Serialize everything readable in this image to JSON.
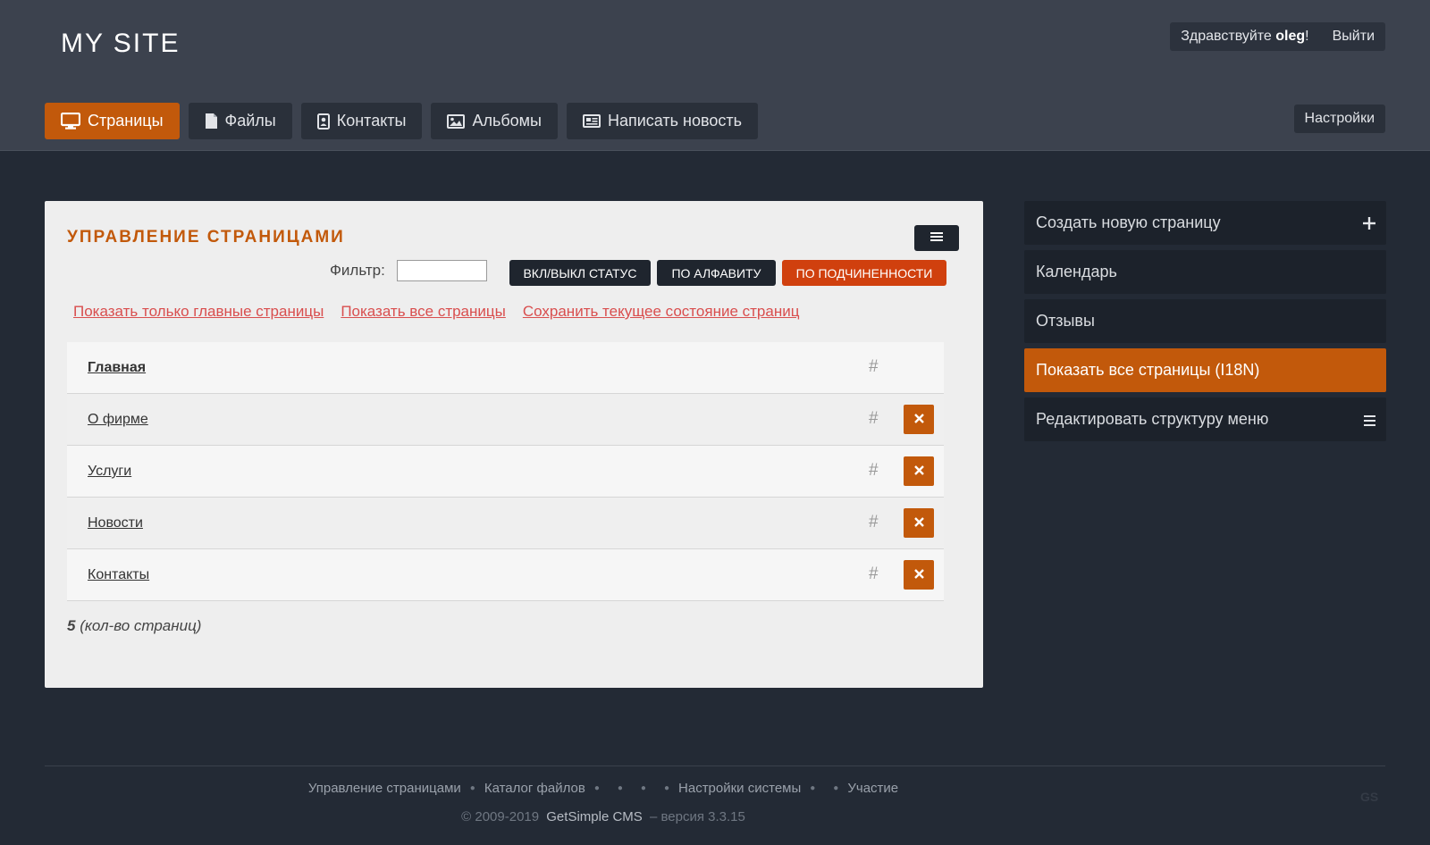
{
  "header": {
    "site_title": "MY SITE",
    "greeting_prefix": "Здравствуйте ",
    "username": "oleg",
    "greeting_suffix": "!",
    "logout_label": "Выйти",
    "settings_label": "Настройки"
  },
  "nav": {
    "tabs": [
      {
        "label": "Страницы",
        "icon": "monitor-icon",
        "active": true
      },
      {
        "label": "Файлы",
        "icon": "file-icon",
        "active": false
      },
      {
        "label": "Контакты",
        "icon": "contact-card-icon",
        "active": false
      },
      {
        "label": "Альбомы",
        "icon": "image-icon",
        "active": false
      },
      {
        "label": "Написать новость",
        "icon": "newspaper-icon",
        "active": false
      }
    ]
  },
  "panel": {
    "title": "УПРАВЛЕНИЕ СТРАНИЦАМИ",
    "menu_icon": "hamburger-icon",
    "filter_label": "Фильтр:",
    "filter_value": "",
    "sort_buttons": [
      {
        "label": "ВКЛ/ВЫКЛ СТАТУС"
      },
      {
        "label": "ПО АЛФАВИТУ"
      },
      {
        "label": "ПО ПОДЧИНЕННОСТИ"
      }
    ],
    "links": [
      "Показать только главные страницы",
      "Показать все страницы",
      "Сохранить текущее состояние страниц"
    ],
    "pages": [
      {
        "title": "Главная",
        "hash": "#",
        "deletable": false
      },
      {
        "title": "О фирме",
        "hash": "#",
        "deletable": true
      },
      {
        "title": "Услуги",
        "hash": "#",
        "deletable": true
      },
      {
        "title": "Новости",
        "hash": "#",
        "deletable": true
      },
      {
        "title": "Контакты",
        "hash": "#",
        "deletable": true
      }
    ],
    "count_number": "5",
    "count_label": " (кол-во страниц)"
  },
  "sidebar": {
    "items": [
      {
        "label": "Создать новую страницу",
        "icon": "plus-icon"
      },
      {
        "label": "Календарь"
      },
      {
        "label": "Отзывы"
      },
      {
        "label": "Показать все страницы (I18N)",
        "active": true
      },
      {
        "label": "Редактировать структуру меню",
        "icon": "hamburger-icon"
      }
    ]
  },
  "footer": {
    "link_1": "Управление страницами",
    "link_2": "Каталог файлов",
    "link_3": "Настройки системы",
    "link_4": "Участие",
    "copyright_prefix": "© 2009-2019",
    "cms_name": "GetSimple CMS",
    "version": "– версия 3.3.15",
    "logo_text": "GS"
  },
  "colors": {
    "accent": "#c2590b",
    "header_bg": "#3c424e",
    "body_bg": "#232a35",
    "danger_button": "#d0400e",
    "link": "#d94e4e"
  }
}
